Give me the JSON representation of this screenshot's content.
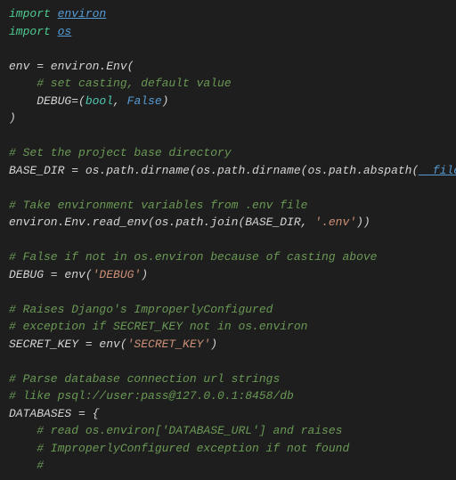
{
  "code": {
    "l1a": "import",
    "l1b": "environ",
    "l2a": "import",
    "l2b": "os",
    "l4": "env = environ.Env(",
    "l5": "    # set casting, default value",
    "l6a": "    DEBUG=(",
    "l6b": "bool",
    "l6c": ", ",
    "l6d": "False",
    "l6e": ")",
    "l7": ")",
    "l9": "# Set the project base directory",
    "l10a": "BASE_DIR = os.path.dirname(os.path.dirname(os.path.abspath(",
    "l10b": "__file__",
    "l10c": ")))",
    "l12": "# Take environment variables from .env file",
    "l13a": "environ.Env.read_env(os.path.join(BASE_DIR, ",
    "l13b": "'.env'",
    "l13c": "))",
    "l15": "# False if not in os.environ because of casting above",
    "l16a": "DEBUG = env(",
    "l16b": "'DEBUG'",
    "l16c": ")",
    "l18": "# Raises Django's ImproperlyConfigured",
    "l19": "# exception if SECRET_KEY not in os.environ",
    "l20a": "SECRET_KEY = env(",
    "l20b": "'SECRET_KEY'",
    "l20c": ")",
    "l22": "# Parse database connection url strings",
    "l23": "# like psql://user:pass@127.0.0.1:8458/db",
    "l24": "DATABASES = {",
    "l25": "    # read os.environ['DATABASE_URL'] and raises",
    "l26": "    # ImproperlyConfigured exception if not found",
    "l27": "    #"
  }
}
